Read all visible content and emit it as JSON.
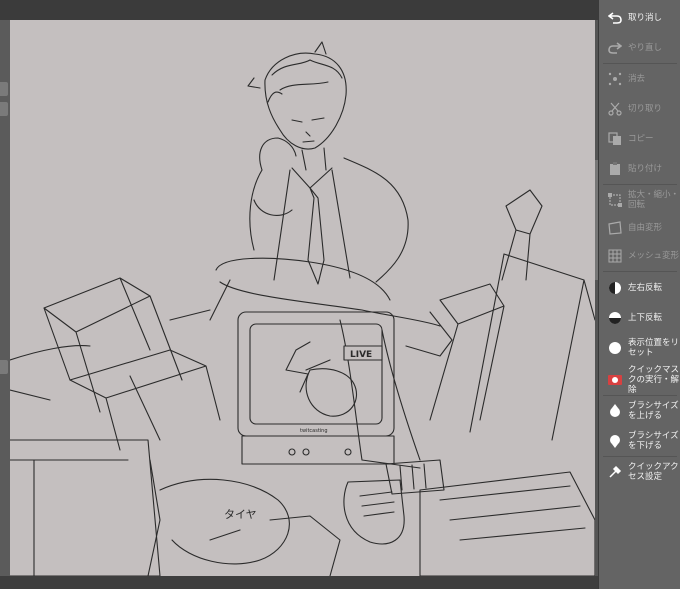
{
  "colors": {
    "canvas_bg": "#c4bfbf",
    "panel_bg": "#646464",
    "label_active": "#f2f2f2",
    "label_disabled": "#9a9a9a",
    "quickmask_red": "#d84040"
  },
  "panel": {
    "items": [
      {
        "label": "取り消し",
        "icon": "undo-icon",
        "enabled": true
      },
      {
        "label": "やり直し",
        "icon": "redo-icon",
        "enabled": false
      },
      {
        "label": "消去",
        "icon": "clear-icon",
        "enabled": false
      },
      {
        "label": "切り取り",
        "icon": "cut-icon",
        "enabled": false
      },
      {
        "label": "コピー",
        "icon": "copy-icon",
        "enabled": false
      },
      {
        "label": "貼り付け",
        "icon": "paste-icon",
        "enabled": false
      },
      {
        "label": "拡大・縮小・\n回転",
        "icon": "scale-rotate-icon",
        "enabled": false
      },
      {
        "label": "自由変形",
        "icon": "free-transform-icon",
        "enabled": false
      },
      {
        "label": "メッシュ変形",
        "icon": "mesh-transform-icon",
        "enabled": false
      },
      {
        "label": "左右反転",
        "icon": "flip-horizontal-icon",
        "enabled": true
      },
      {
        "label": "上下反転",
        "icon": "flip-vertical-icon",
        "enabled": true
      },
      {
        "label": "表示位置をリ\nセット",
        "icon": "reset-view-icon",
        "enabled": true
      },
      {
        "label": "クイックマス\nクの実行・解除",
        "icon": "quick-mask-icon",
        "enabled": true
      },
      {
        "label": "ブラシサイズ\nを上げる",
        "icon": "brush-size-up-icon",
        "enabled": true
      },
      {
        "label": "ブラシサイズ\nを下げる",
        "icon": "brush-size-down-icon",
        "enabled": true
      },
      {
        "label": "クイックアク\nセス設定",
        "icon": "quick-access-settings-icon",
        "enabled": true
      }
    ]
  },
  "canvas": {
    "tv_label": "LIVE",
    "tv_caption": "twitcasting",
    "signature": "タイヤ"
  }
}
